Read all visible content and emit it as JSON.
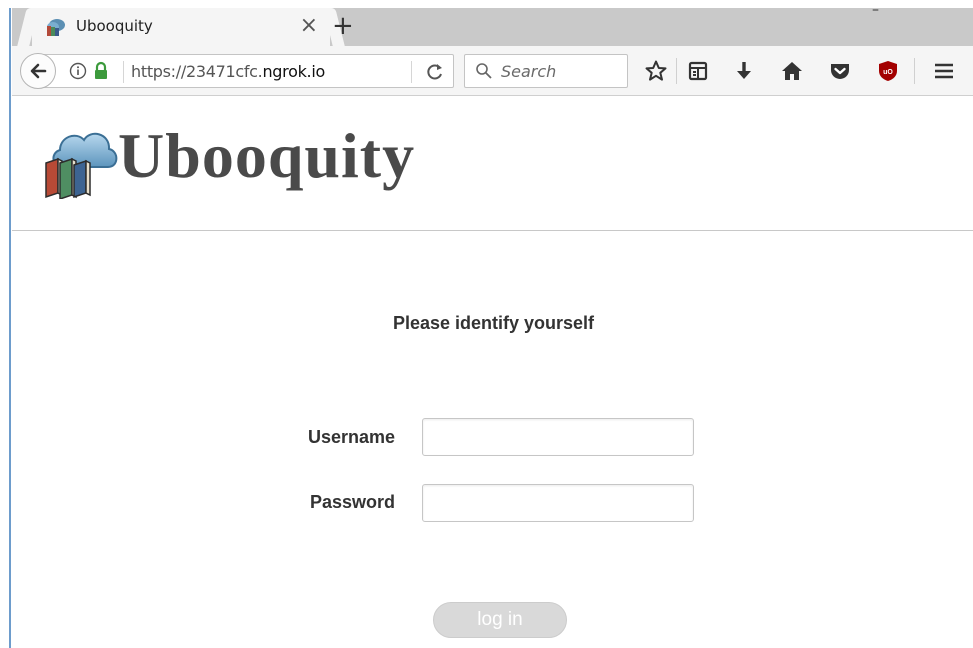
{
  "browser": {
    "tab": {
      "title": "Ubooquity",
      "close_glyph": "×",
      "favicon": "ubooquity-cloud-books-icon"
    },
    "new_tab_glyph": "+",
    "window_controls": "–",
    "url": {
      "prefix": "https://23471cfc.",
      "domain": "ngrok.io"
    },
    "search": {
      "placeholder": "Search"
    },
    "toolbar_icons": [
      "star-icon",
      "reading-list-icon",
      "download-icon",
      "home-icon",
      "pocket-icon",
      "ublock-icon",
      "menu-icon"
    ],
    "colors": {
      "ublock": "#a30000",
      "lock": "#3c9a3c"
    }
  },
  "page": {
    "brand": "Ubooquity",
    "prompt": "Please identify yourself",
    "username_label": "Username",
    "password_label": "Password",
    "username_value": "",
    "password_value": "",
    "login_label": "log in"
  }
}
